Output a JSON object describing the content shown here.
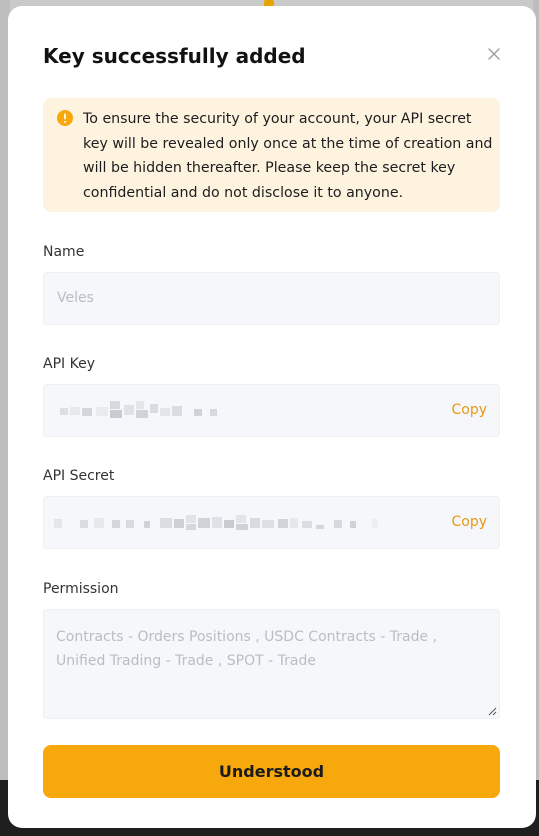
{
  "modal": {
    "title": "Key successfully added",
    "close_icon": "close-icon",
    "warning": {
      "icon": "warning-circle-icon",
      "icon_color": "#f6a80c",
      "background": "#fdf3df",
      "text": "To ensure the security of your account, your API secret key will be revealed only once at the time of creation and will be hidden thereafter. Please keep the secret key confidential and do not disclose it to anyone."
    },
    "fields": {
      "name": {
        "label": "Name",
        "value": "Veles"
      },
      "api_key": {
        "label": "API Key",
        "copy_label": "Copy"
      },
      "api_secret": {
        "label": "API Secret",
        "copy_label": "Copy"
      },
      "permission": {
        "label": "Permission",
        "value": "Contracts - Orders Positions  , USDC Contracts - Trade  ,  Unified Trading - Trade  , SPOT - Trade"
      }
    },
    "button": {
      "label": "Understood",
      "color": "#f6a80c"
    }
  },
  "colors": {
    "accent": "#f6a80c",
    "link": "#e79a0f",
    "input_bg": "#f5f7fa",
    "placeholder_text": "#b9bdc4"
  }
}
